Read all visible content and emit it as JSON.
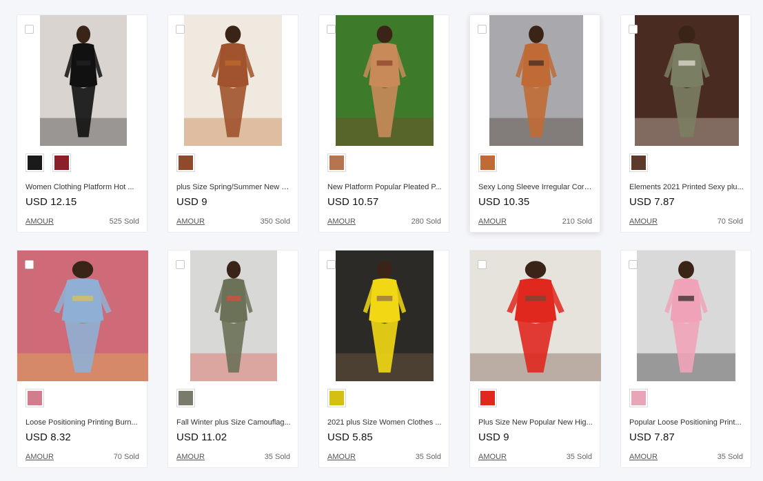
{
  "products": [
    {
      "title": "Women Clothing Platform Hot ...",
      "price": "USD 12.15",
      "brand": "AMOUR",
      "sold": "525 Sold",
      "bg": "#d9d4cf",
      "fig": "#111111",
      "accent": "#222222",
      "thumbs": [
        "#1a1a1a",
        "#8b1f2a"
      ]
    },
    {
      "title": "plus Size Spring/Summer New L...",
      "price": "USD 9",
      "brand": "AMOUR",
      "sold": "350 Sold",
      "bg": "#efe9e0",
      "fig": "#a0532c",
      "accent": "#c26c2b",
      "thumbs": [
        "#8e4a2a"
      ]
    },
    {
      "title": "New Platform Popular Pleated P...",
      "price": "USD 10.57",
      "brand": "AMOUR",
      "sold": "280 Sold",
      "bg": "#3d7a2a",
      "fig": "#c98a5a",
      "accent": "#8a3f2a",
      "thumbs": [
        "#b5754f"
      ]
    },
    {
      "title": "Sexy Long Sleeve Irregular Cord...",
      "price": "USD 10.35",
      "brand": "AMOUR",
      "sold": "210 Sold",
      "bg": "#a9a9ad",
      "fig": "#c06a35",
      "accent": "#3a2a20",
      "thumbs": [
        "#c06a35"
      ]
    },
    {
      "title": "Elements 2021 Printed Sexy plu...",
      "price": "USD 7.87",
      "brand": "AMOUR",
      "sold": "70 Sold",
      "bg": "#4a2b22",
      "fig": "#7a7e62",
      "accent": "#e8e1d8",
      "thumbs": [
        "#5b3a2c"
      ]
    },
    {
      "title": "Loose Positioning Printing Burn...",
      "price": "USD 8.32",
      "brand": "AMOUR",
      "sold": "70 Sold",
      "bg": "#cf6b78",
      "fig": "#8fb0d4",
      "accent": "#e3c24a",
      "thumbs": [
        "#d27d8c"
      ]
    },
    {
      "title": "Fall Winter plus Size Camouflag...",
      "price": "USD 11.02",
      "brand": "AMOUR",
      "sold": "35 Sold",
      "bg": "#d8d8d6",
      "fig": "#6b7258",
      "accent": "#e04a3a",
      "thumbs": [
        "#7a7a6a"
      ]
    },
    {
      "title": "2021 plus Size Women Clothes ...",
      "price": "USD 5.85",
      "brand": "AMOUR",
      "sold": "35 Sold",
      "bg": "#2b2a27",
      "fig": "#f2d814",
      "accent": "#8a6a4a",
      "thumbs": [
        "#d4c013"
      ]
    },
    {
      "title": "Plus Size New Popular New Hig...",
      "price": "USD 9",
      "brand": "AMOUR",
      "sold": "35 Sold",
      "bg": "#e6e2dc",
      "fig": "#e0281f",
      "accent": "#6a4a38",
      "thumbs": [
        "#e0281f"
      ]
    },
    {
      "title": "Popular Loose Positioning Print...",
      "price": "USD 7.87",
      "brand": "AMOUR",
      "sold": "35 Sold",
      "bg": "#d9d9d9",
      "fig": "#f0a3b8",
      "accent": "#222222",
      "thumbs": [
        "#e8a5b8"
      ]
    }
  ]
}
